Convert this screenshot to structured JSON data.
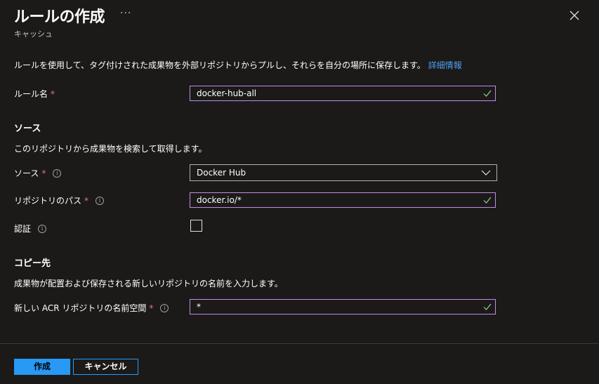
{
  "header": {
    "title": "ルールの作成",
    "more_label": "···",
    "subtitle": "キャッシュ"
  },
  "intro": {
    "text": "ルールを使用して、タグ付けされた成果物を外部リポジトリからプルし、それらを自分の場所に保存します。",
    "link": "詳細情報"
  },
  "rule_name": {
    "label": "ルール名",
    "required": "*",
    "value": "docker-hub-all"
  },
  "source": {
    "heading": "ソース",
    "description": "このリポジトリから成果物を検索して取得します。",
    "source_label": "ソース",
    "source_required": "*",
    "source_value": "Docker Hub",
    "path_label": "リポジトリのパス",
    "path_required": "*",
    "path_value": "docker.io/*",
    "auth_label": "認証",
    "auth_checked": false
  },
  "destination": {
    "heading": "コピー先",
    "description": "成果物が配置および保存される新しいリポジトリの名前を入力します。",
    "ns_label": "新しい ACR リポジトリの名前空間",
    "ns_required": "*",
    "ns_value": "*"
  },
  "footer": {
    "create_label": "作成",
    "cancel_label": "キャンセル"
  },
  "colors": {
    "background": "#1b1a19",
    "accent": "#2899f5",
    "link": "#4f9ff0",
    "required": "#f1707b",
    "input_border": "#c38be8",
    "valid_check": "#8fd18f"
  },
  "icons": {
    "close": "close-icon",
    "info": "info-icon",
    "check": "checkmark-icon",
    "dropdown": "chevron-down-icon",
    "more": "more-icon"
  }
}
